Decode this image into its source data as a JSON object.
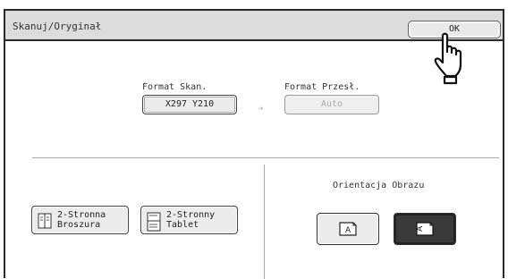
{
  "title": "Skanuj/Oryginał",
  "ok_label": "OK",
  "scan_size": {
    "label": "Format Skan.",
    "value": "X297  Y210"
  },
  "send_size": {
    "label": "Format Przesł.",
    "value": "Auto"
  },
  "duplex": {
    "booklet": {
      "line1": "2-Stronna",
      "line2": "Broszura"
    },
    "tablet": {
      "line1": "2-Stronny",
      "line2": "Tablet"
    }
  },
  "orientation": {
    "label": "Orientacja Obrazu",
    "options": [
      {
        "glyph": "A",
        "selected": false
      },
      {
        "glyph": "A",
        "selected": true
      }
    ]
  },
  "icons": {
    "pointer": "hand-pointer-icon",
    "arrow": "arrow-right-icon",
    "booklet": "booklet-duplex-icon",
    "tablet": "tablet-duplex-icon",
    "portrait": "portrait-orientation-icon",
    "landscape": "landscape-orientation-icon"
  }
}
